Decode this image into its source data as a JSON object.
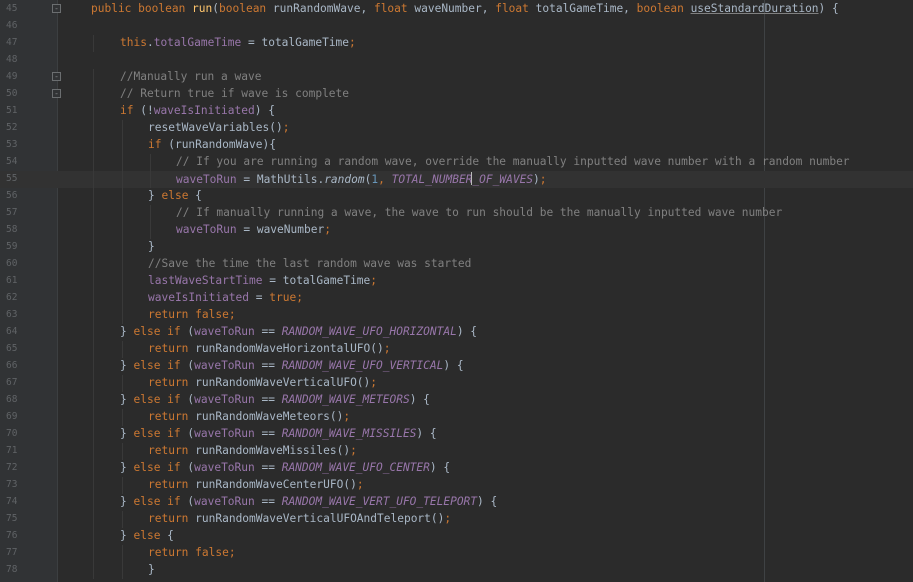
{
  "editor": {
    "lines": [
      {
        "n": "45",
        "fold": "-",
        "indent": 1,
        "tokens": [
          [
            "kw",
            "public "
          ],
          [
            "kw",
            "boolean "
          ],
          [
            "fn",
            "run"
          ],
          [
            "p",
            "("
          ],
          [
            "kw",
            "boolean "
          ],
          [
            "p",
            "runRandomWave, "
          ],
          [
            "kw",
            "float "
          ],
          [
            "p",
            "waveNumber, "
          ],
          [
            "kw",
            "float "
          ],
          [
            "p",
            "totalGameTime, "
          ],
          [
            "kw",
            "boolean "
          ],
          [
            "warn",
            "useStandardDuration"
          ],
          [
            "p",
            ") {"
          ]
        ]
      },
      {
        "n": "46",
        "indent": 0,
        "tokens": []
      },
      {
        "n": "47",
        "indent": 2,
        "tokens": [
          [
            "kw",
            "this"
          ],
          [
            "p",
            "."
          ],
          [
            "fld",
            "totalGameTime"
          ],
          [
            "p",
            " = totalGameTime"
          ],
          [
            "kw",
            ";"
          ]
        ]
      },
      {
        "n": "48",
        "indent": 0,
        "tokens": []
      },
      {
        "n": "49",
        "fold": "-",
        "indent": 2,
        "tokens": [
          [
            "cm",
            "//Manually run a wave"
          ]
        ]
      },
      {
        "n": "50",
        "fold": "-",
        "indent": 2,
        "tokens": [
          [
            "cm",
            "// Return true if wave is complete"
          ]
        ]
      },
      {
        "n": "51",
        "indent": 2,
        "tokens": [
          [
            "kw",
            "if "
          ],
          [
            "p",
            "(!"
          ],
          [
            "fld",
            "waveIsInitiated"
          ],
          [
            "p",
            ") {"
          ]
        ]
      },
      {
        "n": "52",
        "indent": 3,
        "tokens": [
          [
            "p",
            "resetWaveVariables()"
          ],
          [
            "kw",
            ";"
          ]
        ]
      },
      {
        "n": "53",
        "indent": 3,
        "tokens": [
          [
            "kw",
            "if "
          ],
          [
            "p",
            "(runRandomWave){"
          ]
        ]
      },
      {
        "n": "54",
        "indent": 4,
        "tokens": [
          [
            "cm",
            "// If you are running a random wave, override the manually inputted wave number with a random number"
          ]
        ]
      },
      {
        "n": "55",
        "indent": 4,
        "current": true,
        "tokens": [
          [
            "fld",
            "waveToRun"
          ],
          [
            "p",
            " = MathUtils."
          ],
          [
            "stm",
            "random"
          ],
          [
            "p",
            "("
          ],
          [
            "num",
            "1"
          ],
          [
            "kw",
            ", "
          ],
          [
            "const",
            "TOTAL_NUMBER"
          ],
          [
            "caret",
            ""
          ],
          [
            "const",
            "_OF_WAVES"
          ],
          [
            "p",
            ")"
          ],
          [
            "kw",
            ";"
          ]
        ]
      },
      {
        "n": "56",
        "indent": 3,
        "tokens": [
          [
            "p",
            "} "
          ],
          [
            "kw",
            "else "
          ],
          [
            "p",
            "{"
          ]
        ]
      },
      {
        "n": "57",
        "indent": 4,
        "tokens": [
          [
            "cm",
            "// If manually running a wave, the wave to run should be the manually inputted wave number"
          ]
        ]
      },
      {
        "n": "58",
        "indent": 4,
        "tokens": [
          [
            "fld",
            "waveToRun"
          ],
          [
            "p",
            " = waveNumber"
          ],
          [
            "kw",
            ";"
          ]
        ]
      },
      {
        "n": "59",
        "indent": 3,
        "tokens": [
          [
            "p",
            "}"
          ]
        ]
      },
      {
        "n": "60",
        "indent": 3,
        "tokens": [
          [
            "cm",
            "//Save the time the last random wave was started"
          ]
        ]
      },
      {
        "n": "61",
        "indent": 3,
        "tokens": [
          [
            "fld",
            "lastWaveStartTime"
          ],
          [
            "p",
            " = totalGameTime"
          ],
          [
            "kw",
            ";"
          ]
        ]
      },
      {
        "n": "62",
        "indent": 3,
        "tokens": [
          [
            "fld",
            "waveIsInitiated"
          ],
          [
            "p",
            " = "
          ],
          [
            "kw",
            "true;"
          ]
        ]
      },
      {
        "n": "63",
        "indent": 3,
        "tokens": [
          [
            "kw",
            "return false;"
          ]
        ]
      },
      {
        "n": "64",
        "indent": 2,
        "tokens": [
          [
            "p",
            "} "
          ],
          [
            "kw",
            "else if "
          ],
          [
            "p",
            "("
          ],
          [
            "fld",
            "waveToRun"
          ],
          [
            "p",
            " == "
          ],
          [
            "const",
            "RANDOM_WAVE_UFO_HORIZONTAL"
          ],
          [
            "p",
            ") {"
          ]
        ]
      },
      {
        "n": "65",
        "indent": 3,
        "tokens": [
          [
            "kw",
            "return "
          ],
          [
            "p",
            "runRandomWaveHorizontalUFO()"
          ],
          [
            "kw",
            ";"
          ]
        ]
      },
      {
        "n": "66",
        "indent": 2,
        "tokens": [
          [
            "p",
            "} "
          ],
          [
            "kw",
            "else if "
          ],
          [
            "p",
            "("
          ],
          [
            "fld",
            "waveToRun"
          ],
          [
            "p",
            " == "
          ],
          [
            "const",
            "RANDOM_WAVE_UFO_VERTICAL"
          ],
          [
            "p",
            ") {"
          ]
        ]
      },
      {
        "n": "67",
        "indent": 3,
        "tokens": [
          [
            "kw",
            "return "
          ],
          [
            "p",
            "runRandomWaveVerticalUFO()"
          ],
          [
            "kw",
            ";"
          ]
        ]
      },
      {
        "n": "68",
        "indent": 2,
        "tokens": [
          [
            "p",
            "} "
          ],
          [
            "kw",
            "else if "
          ],
          [
            "p",
            "("
          ],
          [
            "fld",
            "waveToRun"
          ],
          [
            "p",
            " == "
          ],
          [
            "const",
            "RANDOM_WAVE_METEORS"
          ],
          [
            "p",
            ") {"
          ]
        ]
      },
      {
        "n": "69",
        "indent": 3,
        "tokens": [
          [
            "kw",
            "return "
          ],
          [
            "p",
            "runRandomWaveMeteors()"
          ],
          [
            "kw",
            ";"
          ]
        ]
      },
      {
        "n": "70",
        "indent": 2,
        "tokens": [
          [
            "p",
            "} "
          ],
          [
            "kw",
            "else if "
          ],
          [
            "p",
            "("
          ],
          [
            "fld",
            "waveToRun"
          ],
          [
            "p",
            " == "
          ],
          [
            "const",
            "RANDOM_WAVE_MISSILES"
          ],
          [
            "p",
            ") {"
          ]
        ]
      },
      {
        "n": "71",
        "indent": 3,
        "tokens": [
          [
            "kw",
            "return "
          ],
          [
            "p",
            "runRandomWaveMissiles()"
          ],
          [
            "kw",
            ";"
          ]
        ]
      },
      {
        "n": "72",
        "indent": 2,
        "tokens": [
          [
            "p",
            "} "
          ],
          [
            "kw",
            "else if "
          ],
          [
            "p",
            "("
          ],
          [
            "fld",
            "waveToRun"
          ],
          [
            "p",
            " == "
          ],
          [
            "const",
            "RANDOM_WAVE_UFO_CENTER"
          ],
          [
            "p",
            ") {"
          ]
        ]
      },
      {
        "n": "73",
        "indent": 3,
        "tokens": [
          [
            "kw",
            "return "
          ],
          [
            "p",
            "runRandomWaveCenterUFO()"
          ],
          [
            "kw",
            ";"
          ]
        ]
      },
      {
        "n": "74",
        "indent": 2,
        "tokens": [
          [
            "p",
            "} "
          ],
          [
            "kw",
            "else if "
          ],
          [
            "p",
            "("
          ],
          [
            "fld",
            "waveToRun"
          ],
          [
            "p",
            " == "
          ],
          [
            "const",
            "RANDOM_WAVE_VERT_UFO_TELEPORT"
          ],
          [
            "p",
            ") {"
          ]
        ]
      },
      {
        "n": "75",
        "indent": 3,
        "tokens": [
          [
            "kw",
            "return "
          ],
          [
            "p",
            "runRandomWaveVerticalUFOAndTeleport()"
          ],
          [
            "kw",
            ";"
          ]
        ]
      },
      {
        "n": "76",
        "indent": 2,
        "tokens": [
          [
            "p",
            "} "
          ],
          [
            "kw",
            "else "
          ],
          [
            "p",
            "{"
          ]
        ]
      },
      {
        "n": "77",
        "indent": 3,
        "tokens": [
          [
            "kw",
            "return false;"
          ]
        ]
      },
      {
        "n": "78",
        "indent": 3,
        "tokens": [
          [
            "p",
            "}"
          ]
        ]
      }
    ]
  },
  "colors": {
    "background": "#2b2b2b",
    "gutter": "#313335",
    "keyword": "#cc7832",
    "method": "#ffc66d",
    "field": "#9876aa",
    "number": "#6897bb",
    "comment": "#808080",
    "text": "#a9b7c6"
  }
}
